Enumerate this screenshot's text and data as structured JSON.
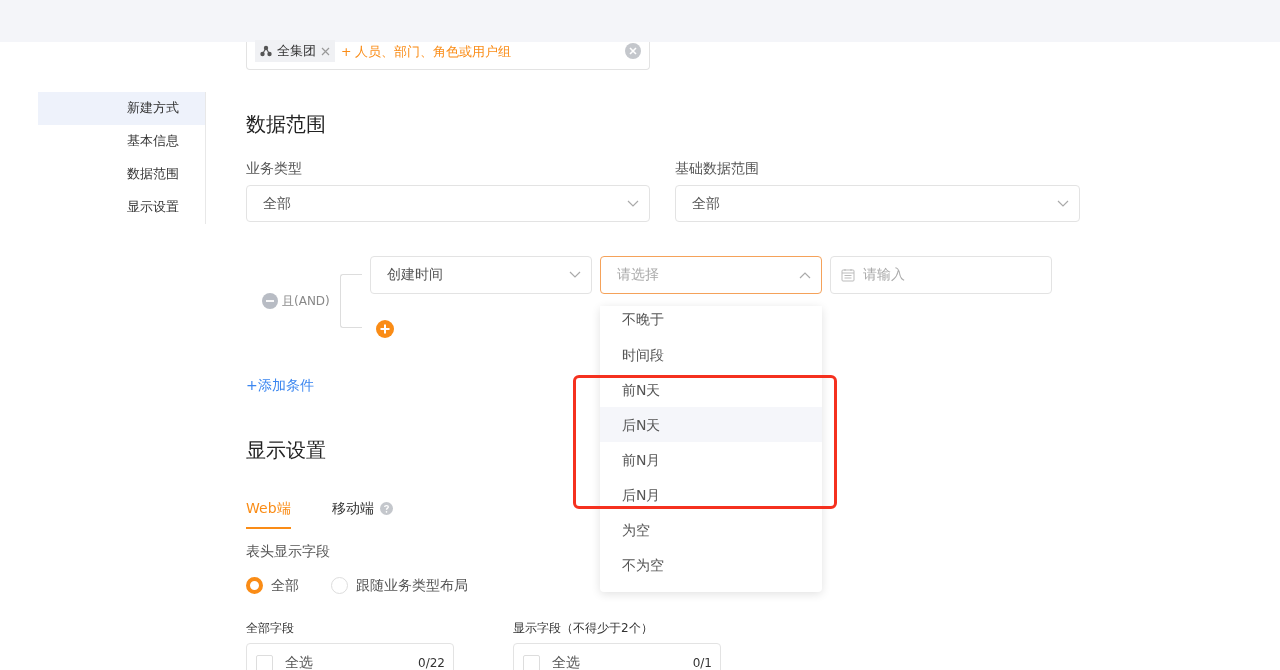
{
  "sidebar": {
    "items": [
      {
        "label": "新建方式",
        "selected": true
      },
      {
        "label": "基本信息",
        "selected": false
      },
      {
        "label": "数据范围",
        "selected": false
      },
      {
        "label": "显示设置",
        "selected": false
      }
    ]
  },
  "scope_field": {
    "tags": [
      {
        "label": "全集团"
      }
    ],
    "add_prompt": "+ 人员、部门、角色或用户组"
  },
  "data_range": {
    "title": "数据范围",
    "fields": [
      {
        "label": "业务类型",
        "value": "全部"
      },
      {
        "label": "基础数据范围",
        "value": "全部"
      }
    ],
    "condition": {
      "logic": "且(AND)",
      "field": "创建时间",
      "operator": {
        "placeholder": "请选择",
        "open": true,
        "options": [
          {
            "label": "不晚于",
            "hovered": false,
            "highlighted": false
          },
          {
            "label": "时间段",
            "hovered": false,
            "highlighted": false
          },
          {
            "label": "前N天",
            "hovered": false,
            "highlighted": true
          },
          {
            "label": "后N天",
            "hovered": true,
            "highlighted": true
          },
          {
            "label": "前N月",
            "hovered": false,
            "highlighted": true
          },
          {
            "label": "后N月",
            "hovered": false,
            "highlighted": true
          },
          {
            "label": "为空",
            "hovered": false,
            "highlighted": false
          },
          {
            "label": "不为空",
            "hovered": false,
            "highlighted": false
          }
        ]
      },
      "value": {
        "placeholder": "请输入"
      }
    },
    "add_condition": "+添加条件"
  },
  "display": {
    "title": "显示设置",
    "tabs": [
      {
        "label": "Web端",
        "selected": true,
        "help": false
      },
      {
        "label": "移动端",
        "selected": false,
        "help": true
      }
    ],
    "header_label": "表头显示字段",
    "radios": [
      {
        "label": "全部",
        "selected": true
      },
      {
        "label": "跟随业务类型布局",
        "selected": false
      }
    ],
    "lists": [
      {
        "title": "全部字段",
        "select_all": "全选",
        "checked": false,
        "count": "0/22"
      },
      {
        "title": "显示字段（不得少于2个）",
        "select_all": "全选",
        "checked": false,
        "count": "0/1"
      }
    ]
  }
}
